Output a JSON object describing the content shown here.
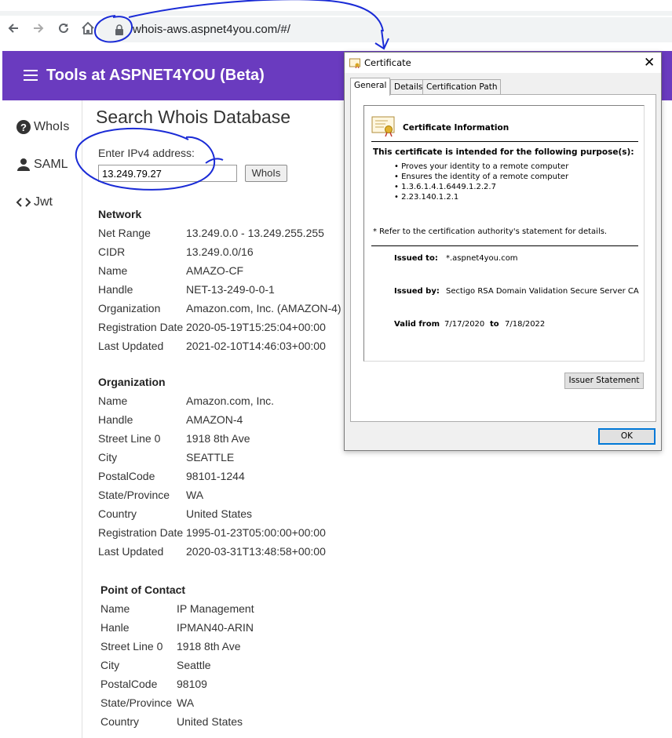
{
  "browser": {
    "url": "whois-aws.aspnet4you.com/#/",
    "back_icon": "back-arrow-icon",
    "forward_icon": "forward-arrow-icon",
    "reload_icon": "reload-icon",
    "home_icon": "home-icon",
    "lock_icon": "lock-icon"
  },
  "header": {
    "title": "Tools at ASPNET4YOU (Beta)",
    "menu_icon": "hamburger-menu-icon",
    "bg_color": "#6a3bbf"
  },
  "sidebar": {
    "items": [
      {
        "label": "WhoIs",
        "icon": "question-circle-icon"
      },
      {
        "label": "SAML",
        "icon": "person-icon"
      },
      {
        "label": "Jwt",
        "icon": "code-brackets-icon"
      }
    ]
  },
  "main": {
    "title": "Search Whois Database",
    "ip_label": "Enter IPv4 address:",
    "ip_value": "13.249.79.27",
    "whois_button": "WhoIs"
  },
  "network": {
    "heading": "Network",
    "rows": [
      {
        "k": "Net Range",
        "v": "13.249.0.0 - 13.249.255.255"
      },
      {
        "k": "CIDR",
        "v": "13.249.0.0/16"
      },
      {
        "k": "Name",
        "v": "AMAZO-CF"
      },
      {
        "k": "Handle",
        "v": "NET-13-249-0-0-1"
      },
      {
        "k": "Organization",
        "v": "Amazon.com, Inc. (AMAZON-4)"
      },
      {
        "k": "Registration Date",
        "v": "2020-05-19T15:25:04+00:00"
      },
      {
        "k": "Last Updated",
        "v": "2021-02-10T14:46:03+00:00"
      }
    ]
  },
  "organization": {
    "heading": "Organization",
    "rows": [
      {
        "k": "Name",
        "v": "Amazon.com, Inc."
      },
      {
        "k": "Handle",
        "v": "AMAZON-4"
      },
      {
        "k": "Street Line 0",
        "v": "1918 8th Ave"
      },
      {
        "k": "City",
        "v": "SEATTLE"
      },
      {
        "k": "PostalCode",
        "v": "98101-1244"
      },
      {
        "k": "State/Province",
        "v": "WA"
      },
      {
        "k": "Country",
        "v": "United States"
      },
      {
        "k": "Registration Date",
        "v": "1995-01-23T05:00:00+00:00"
      },
      {
        "k": "Last Updated",
        "v": "2020-03-31T13:48:58+00:00"
      }
    ]
  },
  "contact": {
    "heading": "Point of Contact",
    "rows": [
      {
        "k": "Name",
        "v": "IP Management"
      },
      {
        "k": "Hanle",
        "v": "IPMAN40-ARIN"
      },
      {
        "k": "Street Line 0",
        "v": "1918 8th Ave"
      },
      {
        "k": "City",
        "v": "Seattle"
      },
      {
        "k": "PostalCode",
        "v": "98109"
      },
      {
        "k": "State/Province",
        "v": "WA"
      },
      {
        "k": "Country",
        "v": "United States"
      }
    ]
  },
  "certificate": {
    "window_title": "Certificate",
    "close_glyph": "✕",
    "tabs": [
      "General",
      "Details",
      "Certification Path"
    ],
    "info_title": "Certificate Information",
    "purpose_title": "This certificate is intended for the following purpose(s):",
    "purposes": [
      "• Proves your identity to a remote computer",
      "• Ensures the identity of a remote computer",
      "• 1.3.6.1.4.1.6449.1.2.2.7",
      "• 2.23.140.1.2.1"
    ],
    "refer_note": "* Refer to the certification authority's statement for details.",
    "issued_to_label": "Issued to:",
    "issued_to": "*.aspnet4you.com",
    "issued_by_label": "Issued by:",
    "issued_by": "Sectigo RSA Domain Validation Secure Server CA",
    "valid_from_label": "Valid from",
    "valid_from": "7/17/2020",
    "to_label": "to",
    "valid_to": "7/18/2022",
    "issuer_button": "Issuer Statement",
    "ok_button": "OK"
  }
}
